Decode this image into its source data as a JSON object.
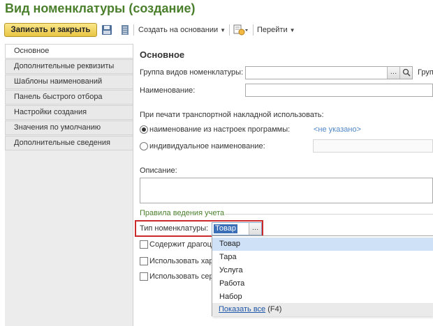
{
  "window": {
    "title": "Вид номенклатуры (создание)"
  },
  "toolbar": {
    "save_close": "Записать и закрыть",
    "create_based_on": "Создать на основании",
    "go_to": "Перейти"
  },
  "sidebar": {
    "items": [
      {
        "label": "Основное"
      },
      {
        "label": "Дополнительные реквизиты"
      },
      {
        "label": "Шаблоны наименований"
      },
      {
        "label": "Панель быстрого отбора"
      },
      {
        "label": "Настройки создания"
      },
      {
        "label": "Значения по умолчанию"
      },
      {
        "label": "Дополнительные сведения"
      }
    ]
  },
  "main": {
    "section_title": "Основное",
    "group_label": "Группа видов номенклатуры:",
    "group_value": "",
    "group_right_label": "Групп",
    "name_label": "Наименование:",
    "name_value": "",
    "print_label": "При печати транспортной накладной использовать:",
    "radio_program": "наименование из настроек программы:",
    "not_specified": "<не указано>",
    "radio_individual": "индивидуальное наименование:",
    "description_label": "Описание:",
    "rules_group": "Правила ведения учета",
    "type_label": "Тип номенклатуры:",
    "type_value": "Товар",
    "chk_precious": "Содержит драгоц",
    "chk_use_char": "Использовать хар",
    "chk_use_series": "Использовать сер"
  },
  "dropdown": {
    "options": [
      "Товар",
      "Тара",
      "Услуга",
      "Работа",
      "Набор"
    ],
    "show_all_link": "Показать все",
    "show_all_key": "(F4)"
  },
  "colors": {
    "title": "#4a7f2c",
    "highlight": "#cc2a2a",
    "link": "#1c55a8"
  }
}
